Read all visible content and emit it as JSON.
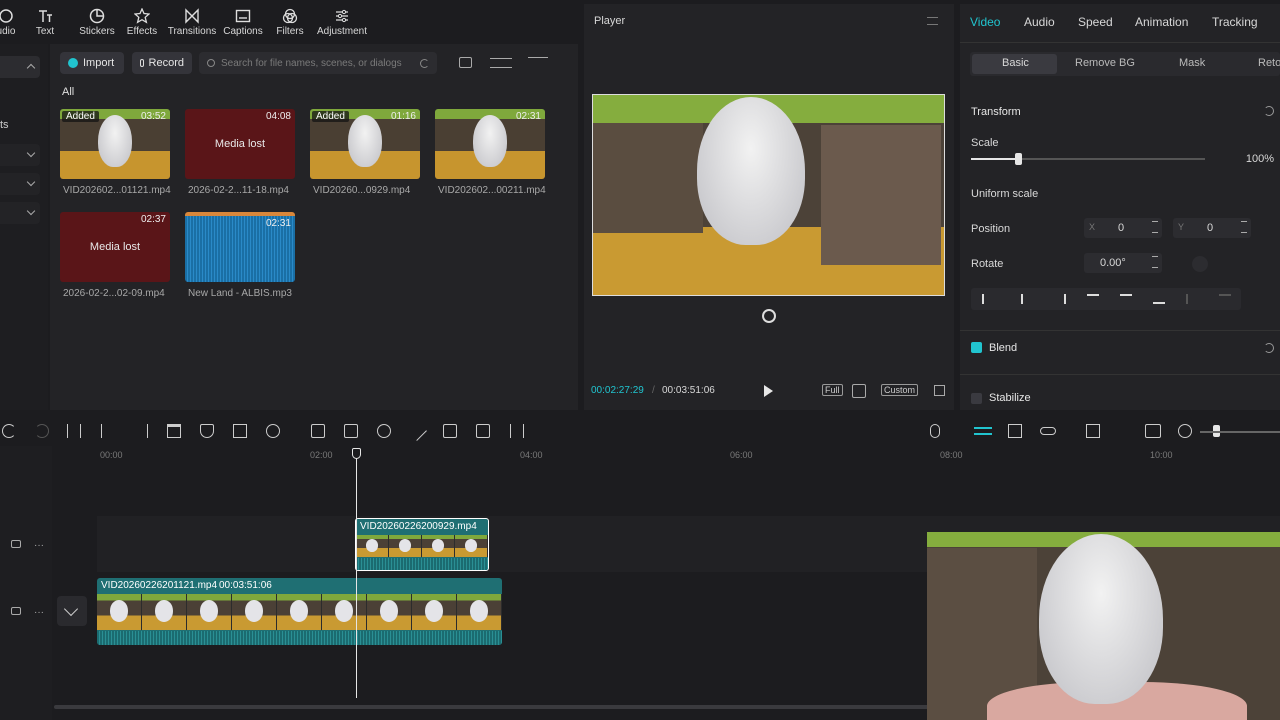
{
  "toolbar": {
    "tools": [
      {
        "label": "udio",
        "icon": "audio-icon"
      },
      {
        "label": "Text",
        "icon": "text-icon"
      },
      {
        "label": "Stickers",
        "icon": "stickers-icon"
      },
      {
        "label": "Effects",
        "icon": "effects-icon"
      },
      {
        "label": "Transitions",
        "icon": "transitions-icon"
      },
      {
        "label": "Captions",
        "icon": "captions-icon"
      },
      {
        "label": "Filters",
        "icon": "filters-icon"
      },
      {
        "label": "Adjustment",
        "icon": "adjustment-icon"
      }
    ]
  },
  "sidebar": {
    "partial_label": "ts"
  },
  "media": {
    "import_label": "Import",
    "record_label": "Record",
    "search_placeholder": "Search for file names, scenes, or dialogs",
    "filter_all": "All",
    "items": [
      {
        "name": "VID202602...01121.mp4",
        "duration": "03:52",
        "badge": "Added",
        "lost": false
      },
      {
        "name": "2026-02-2...11-18.mp4",
        "duration": "04:08",
        "badge": "",
        "lost": true,
        "lost_text": "Media lost"
      },
      {
        "name": "VID20260...0929.mp4",
        "duration": "01:16",
        "badge": "Added",
        "lost": false
      },
      {
        "name": "VID202602...00211.mp4",
        "duration": "02:31",
        "badge": "",
        "lost": false
      },
      {
        "name": "2026-02-2...02-09.mp4",
        "duration": "02:37",
        "badge": "",
        "lost": true,
        "lost_text": "Media lost"
      },
      {
        "name": "New Land - ALBIS.mp3",
        "duration": "02:31",
        "badge": "",
        "lost": false
      }
    ]
  },
  "player": {
    "title": "Player",
    "current_time": "00:02:27:29",
    "total_time": "00:03:51:06",
    "full_label": "Full",
    "custom_label": "Custom"
  },
  "properties": {
    "tabs": [
      "Video",
      "Audio",
      "Speed",
      "Animation",
      "Tracking"
    ],
    "active_tab": "Video",
    "subtabs": [
      "Basic",
      "Remove BG",
      "Mask",
      "Reto"
    ],
    "active_subtab": "Basic",
    "transform_label": "Transform",
    "scale_label": "Scale",
    "scale_value": "100%",
    "scale_fraction": 0.2,
    "uniform_scale_label": "Uniform scale",
    "position_label": "Position",
    "x_label": "X",
    "x_value": "0",
    "y_label": "Y",
    "y_value": "0",
    "rotate_label": "Rotate",
    "rotate_value": "0.00°",
    "blend_label": "Blend",
    "blend_checked": true,
    "stabilize_label": "Stabilize",
    "stabilize_checked": false
  },
  "timeline": {
    "ruler": [
      "00:00",
      "02:00",
      "04:00",
      "06:00",
      "08:00",
      "10:00"
    ],
    "overlay_clip": {
      "name": "VID20260226200929.mp4"
    },
    "main_clip": {
      "name": "VID20260226201121.mp4",
      "duration": "00:03:51:06"
    }
  },
  "colors": {
    "accent": "#21c4cf",
    "clip": "#1f6f73",
    "lost": "#5a1518"
  }
}
